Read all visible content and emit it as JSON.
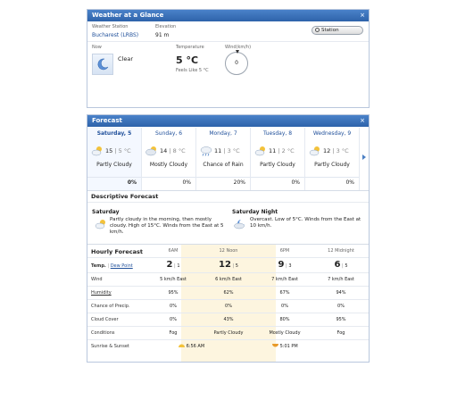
{
  "glance": {
    "title": "Weather at a Glance",
    "close_glyph": "×",
    "station_label": "Weather Station",
    "station_name": "Bucharest (LRBS)",
    "elevation_label": "Elevation",
    "elevation_value": "91 m",
    "station_button": "Station",
    "now_label": "Now",
    "now_condition": "Clear",
    "now_icon": "crescent-moon-icon",
    "temp_label": "Temperature",
    "temp_value": "5 °C",
    "feels_like": "Feels Like 5 °C",
    "wind_label": "Wind(km/h)",
    "wind_value": "0"
  },
  "forecast": {
    "title": "Forecast",
    "close_glyph": "×",
    "days": [
      {
        "name": "Saturday, 5",
        "hi": "15",
        "lo": "5 °C",
        "cond": "Partly Cloudy",
        "pct": "0%",
        "icon": "partly-cloudy-icon"
      },
      {
        "name": "Sunday, 6",
        "hi": "14",
        "lo": "8 °C",
        "cond": "Mostly Cloudy",
        "pct": "0%",
        "icon": "mostly-cloudy-icon"
      },
      {
        "name": "Monday, 7",
        "hi": "11",
        "lo": "3 °C",
        "cond": "Chance of Rain",
        "pct": "20%",
        "icon": "rain-icon"
      },
      {
        "name": "Tuesday, 8",
        "hi": "11",
        "lo": "2 °C",
        "cond": "Partly Cloudy",
        "pct": "0%",
        "icon": "partly-cloudy-icon"
      },
      {
        "name": "Wednesday, 9",
        "hi": "12",
        "lo": "3 °C",
        "cond": "Partly Cloudy",
        "pct": "0%",
        "icon": "partly-cloudy-icon"
      }
    ],
    "descriptive_title": "Descriptive Forecast",
    "desc": [
      {
        "title": "Saturday",
        "text": "Partly cloudy in the morning, then mostly cloudy. High of 15°C. Winds from the East at 5 km/h.",
        "icon": "partly-cloudy-icon"
      },
      {
        "title": "Saturday Night",
        "text": "Overcast. Low of 5°C. Winds from the East at 10 km/h.",
        "icon": "cloudy-night-icon"
      }
    ],
    "hourly": {
      "title": "Hourly Forecast",
      "times": [
        "6AM",
        "12 Noon",
        "6PM",
        "12 Midnight"
      ],
      "temp_label": "Temp.",
      "dew_label": "Dew Point",
      "temps": [
        {
          "t": "2",
          "d": "1"
        },
        {
          "t": "12",
          "d": "5"
        },
        {
          "t": "9",
          "d": "3"
        },
        {
          "t": "6",
          "d": "5"
        }
      ],
      "rows": [
        {
          "label": "Wind",
          "vals": [
            "5 km/h East",
            "6 km/h East",
            "7 km/h East",
            "7 km/h East"
          ]
        },
        {
          "label": "Humidity",
          "vals": [
            "95%",
            "62%",
            "67%",
            "94%"
          ]
        },
        {
          "label": "Chance of Precip.",
          "vals": [
            "0%",
            "0%",
            "0%",
            "0%"
          ]
        },
        {
          "label": "Cloud Cover",
          "vals": [
            "0%",
            "43%",
            "80%",
            "95%"
          ]
        },
        {
          "label": "Conditions",
          "vals": [
            "Fog",
            "Partly Cloudy",
            "Mostly Cloudy",
            "Fog"
          ]
        }
      ],
      "sun_label": "Sunrise & Sunset",
      "sunrise": "6:56 AM",
      "sunset": "5:01 PM"
    }
  }
}
